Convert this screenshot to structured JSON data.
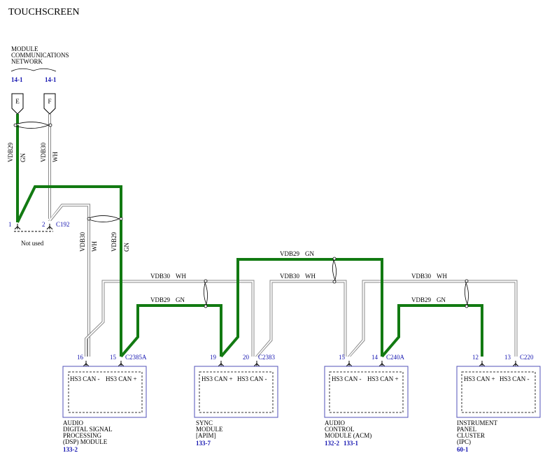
{
  "title": "TOUCHSCREEN",
  "network": {
    "label_lines": [
      "MODULE",
      "COMMUNICATIONS",
      "NETWORK"
    ],
    "refs": [
      "14-1",
      "14-1"
    ],
    "connectors": [
      "E",
      "F"
    ]
  },
  "wires": {
    "vdb29": "VDB29",
    "vdb30": "VDB30",
    "gn": "GN",
    "wh": "WH"
  },
  "c192": {
    "pin1": "1",
    "pin2": "2",
    "name": "C192",
    "not_used": "Not used"
  },
  "modules": [
    {
      "pins": [
        "16",
        "15"
      ],
      "connector": "C2385A",
      "pin_labels": [
        "HS3 CAN -",
        "HS3 CAN +"
      ],
      "name_lines": [
        "AUDIO",
        "DIGITAL SIGNAL",
        "PROCESSING",
        "(DSP) MODULE"
      ],
      "refs": [
        "133-2"
      ]
    },
    {
      "pins": [
        "19",
        "20"
      ],
      "connector": "C2383",
      "pin_labels": [
        "HS3 CAN +",
        "HS3 CAN -"
      ],
      "name_lines": [
        "SYNC",
        "MODULE",
        "[APIM]"
      ],
      "refs": [
        "133-7"
      ]
    },
    {
      "pins": [
        "15",
        "14"
      ],
      "connector": "C240A",
      "pin_labels": [
        "HS3 CAN -",
        "HS3 CAN +"
      ],
      "name_lines": [
        "AUDIO",
        "CONTROL",
        "MODULE (ACM)"
      ],
      "refs": [
        "132-2",
        "133-1"
      ]
    },
    {
      "pins": [
        "12",
        "13"
      ],
      "connector": "C220",
      "pin_labels": [
        "HS3 CAN +",
        "HS3 CAN -"
      ],
      "name_lines": [
        "INSTRUMENT",
        "PANEL",
        "CLUSTER",
        "(IPC)"
      ],
      "refs": [
        "60-1"
      ]
    }
  ]
}
